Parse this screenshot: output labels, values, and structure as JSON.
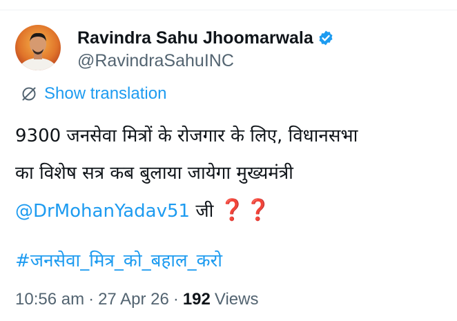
{
  "author": {
    "display_name": "Ravindra Sahu Jhoomarwala",
    "handle": "@RavindraSahuINC",
    "verified": true
  },
  "translation": {
    "label": "Show translation",
    "icon": "globe-slash-icon"
  },
  "tweet": {
    "line1": "9300 जनसेवा मित्रों के रोजगार के लिए, विधानसभा",
    "line2": "का विशेष सत्र कब बुलाया जायेगा मुख्यमंत्री",
    "mention": "@DrMohanYadav51",
    "line3_suffix": " जी ",
    "emoji": "❓❓",
    "hashtag": "#जनसेवा_मित्र_को_बहाल_करो"
  },
  "meta": {
    "time": "10:56 am",
    "separator": "·",
    "date": "27 Apr 26",
    "views_count": "192",
    "views_label": "Views"
  },
  "colors": {
    "link": "#1d9bf0",
    "secondary_text": "#536471",
    "primary_text": "#0f1419",
    "verified_badge": "#1d9bf0",
    "question_mark": "#dd2e44"
  }
}
